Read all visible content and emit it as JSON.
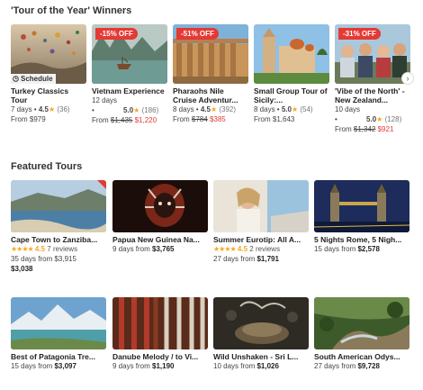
{
  "sections": {
    "winners_title": "'Tour of the Year' Winners",
    "featured_title": "Featured Tours"
  },
  "winners": [
    {
      "name": "Turkey Classics Tour",
      "days": "7  days",
      "rating": "4.5",
      "reviews": "(36)",
      "price_label": "From $979",
      "overlay": "Schedule"
    },
    {
      "name": "Vietnam Experience",
      "badge": "-15% OFF",
      "days": "12  days",
      "rating": "5.0",
      "reviews": "(186)",
      "from": "From",
      "old": "$1,435",
      "new": "$1,220"
    },
    {
      "name": "Pharaohs Nile Cruise Adventur...",
      "badge": "-51% OFF",
      "days": "8  days",
      "rating": "4.5",
      "reviews": "(392)",
      "from": "From",
      "old": "$784",
      "new": "$385"
    },
    {
      "name": "Small Group Tour of Sicily:...",
      "days": "8  days",
      "rating": "5.0",
      "reviews": "(54)",
      "price_label": "From $1,643"
    },
    {
      "name": "'Vibe of the North' - New Zealand...",
      "badge": "-31% OFF",
      "days": "10  days",
      "rating": "5.0",
      "reviews": "(128)",
      "from": "From",
      "old": "$1,342",
      "new": "$921"
    }
  ],
  "featured_row1": [
    {
      "name": "Cape Town to Zanziba...",
      "rating": "4.5",
      "reviews": "7 reviews",
      "days": "35 days from $3,915",
      "price": "$3,038"
    },
    {
      "name": "Papua New Guinea Na...",
      "days": "9 days from",
      "price": "$3,765"
    },
    {
      "name": "Summer Eurotip: All A...",
      "rating": "4.5",
      "reviews": "2 reviews",
      "days": "27 days from",
      "price": "$1,791"
    },
    {
      "name": "5 Nights Rome, 5 Nigh...",
      "days": "15 days from",
      "price": "$2,578"
    }
  ],
  "featured_row2": [
    {
      "name": "Best of Patagonia Tre...",
      "days": "15 days from",
      "price": "$3,097"
    },
    {
      "name": "Danube Melody / to Vi...",
      "days": "9 days from",
      "price": "$1,190"
    },
    {
      "name": "Wild Unshaken - Sri L...",
      "days": "10 days from",
      "price": "$1,026"
    },
    {
      "name": "South American Odys...",
      "days": "27 days from",
      "price": "$9,728"
    }
  ],
  "icons": {
    "next": "chevron-right-icon",
    "schedule": "clock-icon",
    "star": "star-icon"
  },
  "colors": {
    "sale_red": "#e53935",
    "star": "#f5a623"
  }
}
